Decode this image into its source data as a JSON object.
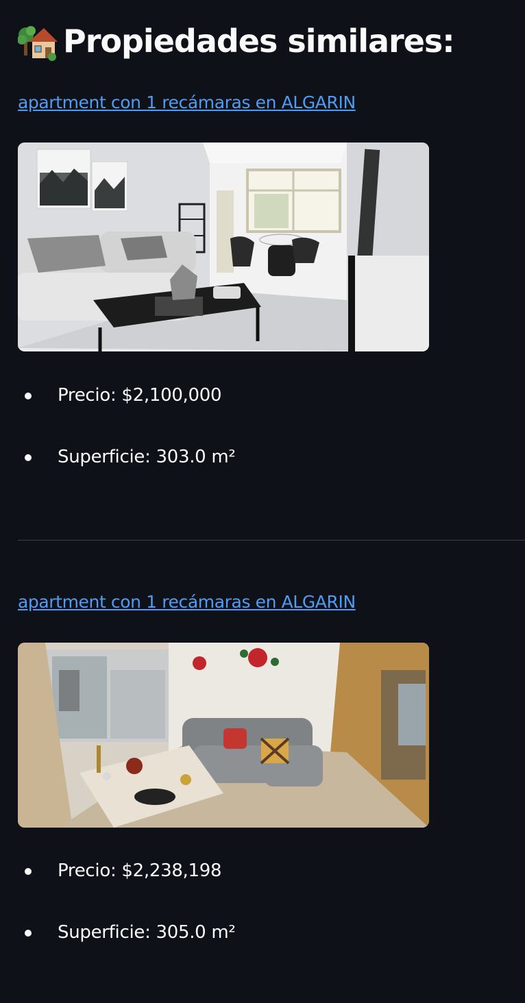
{
  "header": {
    "icon": "house-with-tree-icon",
    "title": "Propiedades similares:"
  },
  "listings": [
    {
      "link_text": "apartment con 1 recámaras en ALGARIN",
      "photo": "living-room-photo",
      "bullets": [
        "Precio: $2,100,000",
        "Superficie: 303.0 m²"
      ]
    },
    {
      "link_text": "apartment con 1 recámaras en ALGARIN",
      "photo": "living-room-photo",
      "bullets": [
        "Precio: $2,238,198",
        "Superficie: 305.0 m²"
      ]
    }
  ],
  "colors": {
    "background": "#0e1117",
    "link": "#4f9cf5",
    "text": "#fafafa",
    "divider": "#3b3f48"
  }
}
